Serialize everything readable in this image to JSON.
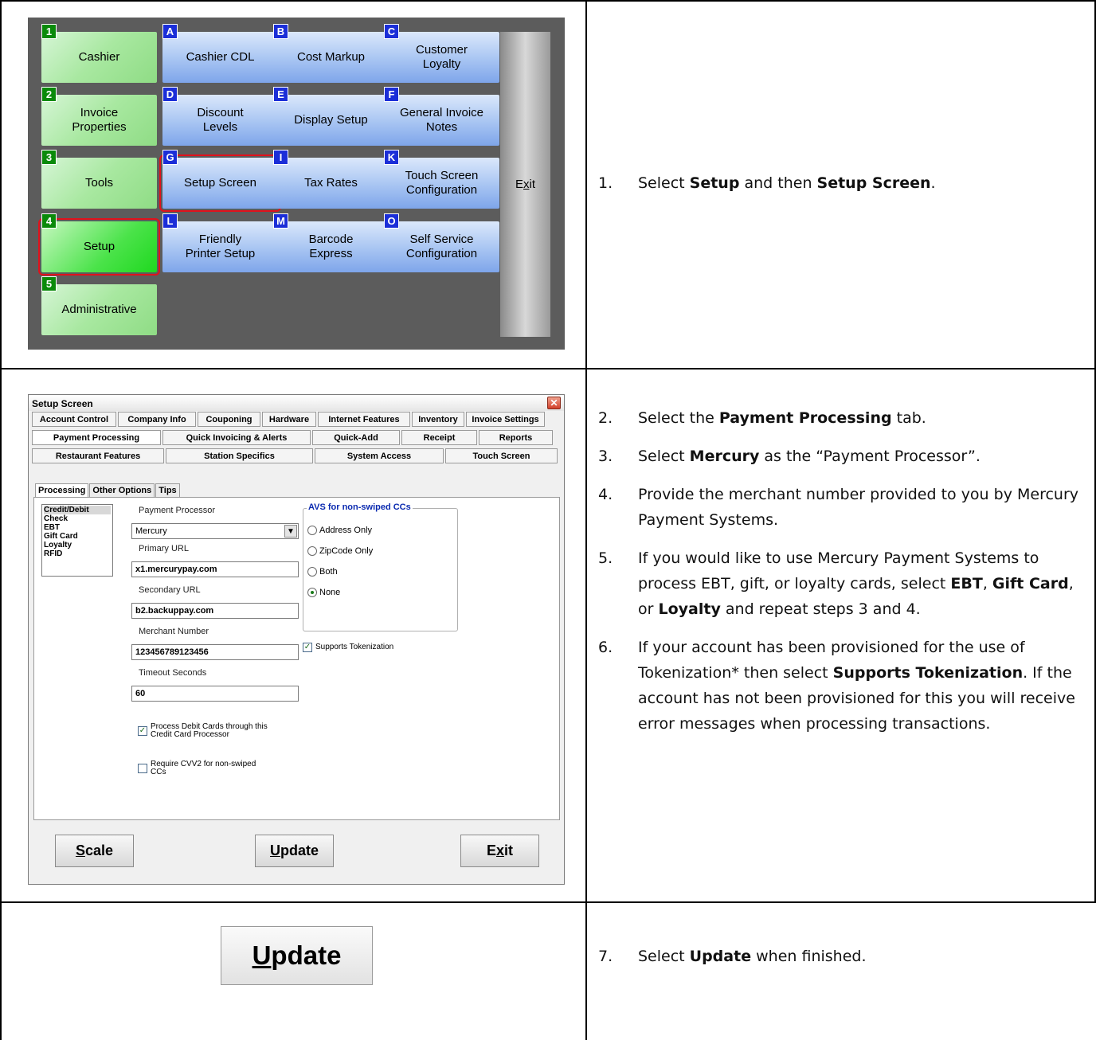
{
  "menu": {
    "green_tiles": [
      {
        "key": "1",
        "label": "Cashier"
      },
      {
        "key": "2",
        "label": "Invoice Properties"
      },
      {
        "key": "3",
        "label": "Tools"
      },
      {
        "key": "4",
        "label": "Setup"
      },
      {
        "key": "5",
        "label": "Administrative"
      }
    ],
    "blue_tiles": [
      {
        "key": "A",
        "label": "Cashier CDL"
      },
      {
        "key": "B",
        "label": "Cost Markup"
      },
      {
        "key": "C",
        "label": "Customer Loyalty"
      },
      {
        "key": "D",
        "label": "Discount Levels"
      },
      {
        "key": "E",
        "label": "Display Setup"
      },
      {
        "key": "F",
        "label": "General Invoice Notes"
      },
      {
        "key": "G",
        "label": "Setup Screen"
      },
      {
        "key": "I",
        "label": "Tax Rates"
      },
      {
        "key": "K",
        "label": "Touch Screen Configuration"
      },
      {
        "key": "L",
        "label": "Friendly Printer Setup"
      },
      {
        "key": "M",
        "label": "Barcode Express"
      },
      {
        "key": "O",
        "label": "Self Service Configuration"
      }
    ],
    "exit_pre": "E",
    "exit_u": "x",
    "exit_post": "it"
  },
  "setup_window": {
    "title": "Setup Screen",
    "close_glyph": "✕",
    "tab_row1": [
      "Account Control",
      "Company Info",
      "Couponing",
      "Hardware",
      "Internet Features",
      "Inventory",
      "Invoice Settings"
    ],
    "tab_row2": [
      "Payment Processing",
      "Quick Invoicing & Alerts",
      "Quick-Add",
      "Receipt",
      "Reports"
    ],
    "tab_row3": [
      "Restaurant Features",
      "Station Specifics",
      "System Access",
      "Touch Screen"
    ],
    "subtabs": [
      "Processing",
      "Other Options",
      "Tips"
    ],
    "list_items": [
      "Credit/Debit",
      "Check",
      "EBT",
      "Gift Card",
      "Loyalty",
      "RFID"
    ],
    "payment_processor_label": "Payment Processor",
    "payment_processor_value": "Mercury",
    "primary_url_label": "Primary URL",
    "primary_url_value": "x1.mercurypay.com",
    "secondary_url_label": "Secondary URL",
    "secondary_url_value": "b2.backuppay.com",
    "merchant_number_label": "Merchant Number",
    "merchant_number_value": "123456789123456",
    "timeout_label": "Timeout Seconds",
    "timeout_value": "60",
    "avs_legend": "AVS for non-swiped CCs",
    "avs_options": [
      "Address Only",
      "ZipCode Only",
      "Both",
      "None"
    ],
    "avs_selected": "None",
    "supports_tokenization": "Supports Tokenization",
    "process_debit_line1": "Process Debit Cards through this",
    "process_debit_line2": "Credit Card Processor",
    "require_cvv_line1": "Require CVV2 for non-swiped",
    "require_cvv_line2": "CCs",
    "buttons": {
      "scale_u": "S",
      "scale_rest": "cale",
      "update_u": "U",
      "update_rest": "pdate",
      "exit_pre": "E",
      "exit_u": "x",
      "exit_post": "it"
    }
  },
  "big_update": {
    "u": "U",
    "rest": "pdate"
  },
  "steps": {
    "s1": {
      "num": "1.",
      "pre": "Select ",
      "b1": "Setup",
      "mid": " and then ",
      "b2": "Setup Screen",
      "post": "."
    },
    "s2": {
      "num": "2.",
      "pre": "Select the ",
      "b1": "Payment Processing",
      "post": " tab."
    },
    "s3": {
      "num": "3.",
      "pre": "Select ",
      "b1": "Mercury",
      "post": " as the “Payment Processor”."
    },
    "s4": {
      "num": "4.",
      "text": "Provide the merchant number provided to you by Mercury Payment Systems."
    },
    "s5": {
      "num": "5.",
      "pre": "If you would like to use Mercury Payment Systems to process EBT, gift, or loyalty cards, select ",
      "b1": "EBT",
      "sep1": ", ",
      "b2": "Gift Card",
      "sep2": ", or ",
      "b3": "Loyalty",
      "post": " and repeat steps 3 and 4."
    },
    "s6": {
      "num": "6.",
      "pre": "If your account has been provisioned for the use of Tokenization* then select ",
      "b1": "Supports Tokenization",
      "post": ". If the account has not been provisioned for this you will receive error messages when processing transactions."
    },
    "s7": {
      "num": "7.",
      "pre": "Select ",
      "b1": "Update",
      "post": " when finished."
    }
  }
}
